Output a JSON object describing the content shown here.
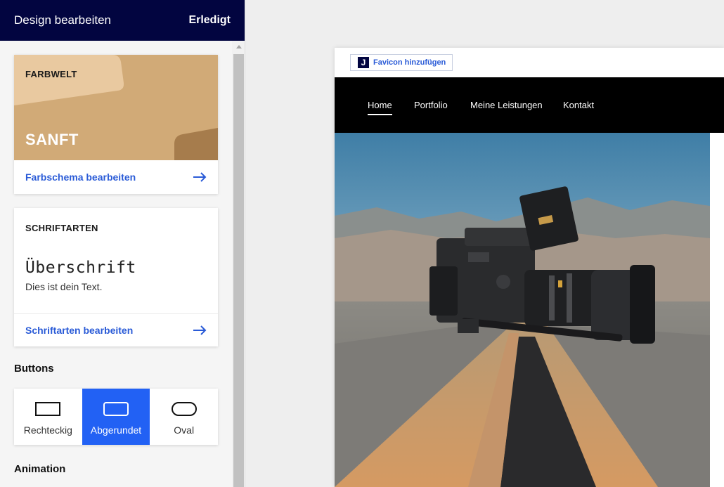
{
  "sidebar": {
    "title": "Design bearbeiten",
    "done_label": "Erledigt",
    "farbwelt": {
      "label": "FARBWELT",
      "name": "SANFT",
      "edit_label": "Farbschema bearbeiten",
      "colors": [
        "#e9c9a0",
        "#d1aa77",
        "#a67c4c"
      ]
    },
    "schriftarten": {
      "label": "SCHRIFTARTEN",
      "heading_sample": "Überschrift",
      "body_sample": "Dies ist dein Text.",
      "edit_label": "Schriftarten bearbeiten"
    },
    "buttons": {
      "title": "Buttons",
      "options": [
        {
          "label": "Rechteckig",
          "icon": "rectangle-shape-icon"
        },
        {
          "label": "Abgerundet",
          "icon": "rounded-shape-icon",
          "selected": true
        },
        {
          "label": "Oval",
          "icon": "oval-shape-icon"
        }
      ]
    },
    "animation_title": "Animation"
  },
  "preview": {
    "favicon_logo": "J",
    "favicon_label": "Favicon hinzufügen",
    "nav": [
      "Home",
      "Portfolio",
      "Meine Leistungen",
      "Kontakt"
    ],
    "active_nav": "Home",
    "hero_image": "camera-on-road-photo"
  },
  "colors": {
    "header_bg": "#020540",
    "accent": "#2261f4",
    "link": "#2a5bd7",
    "nav_bg": "#000000"
  }
}
